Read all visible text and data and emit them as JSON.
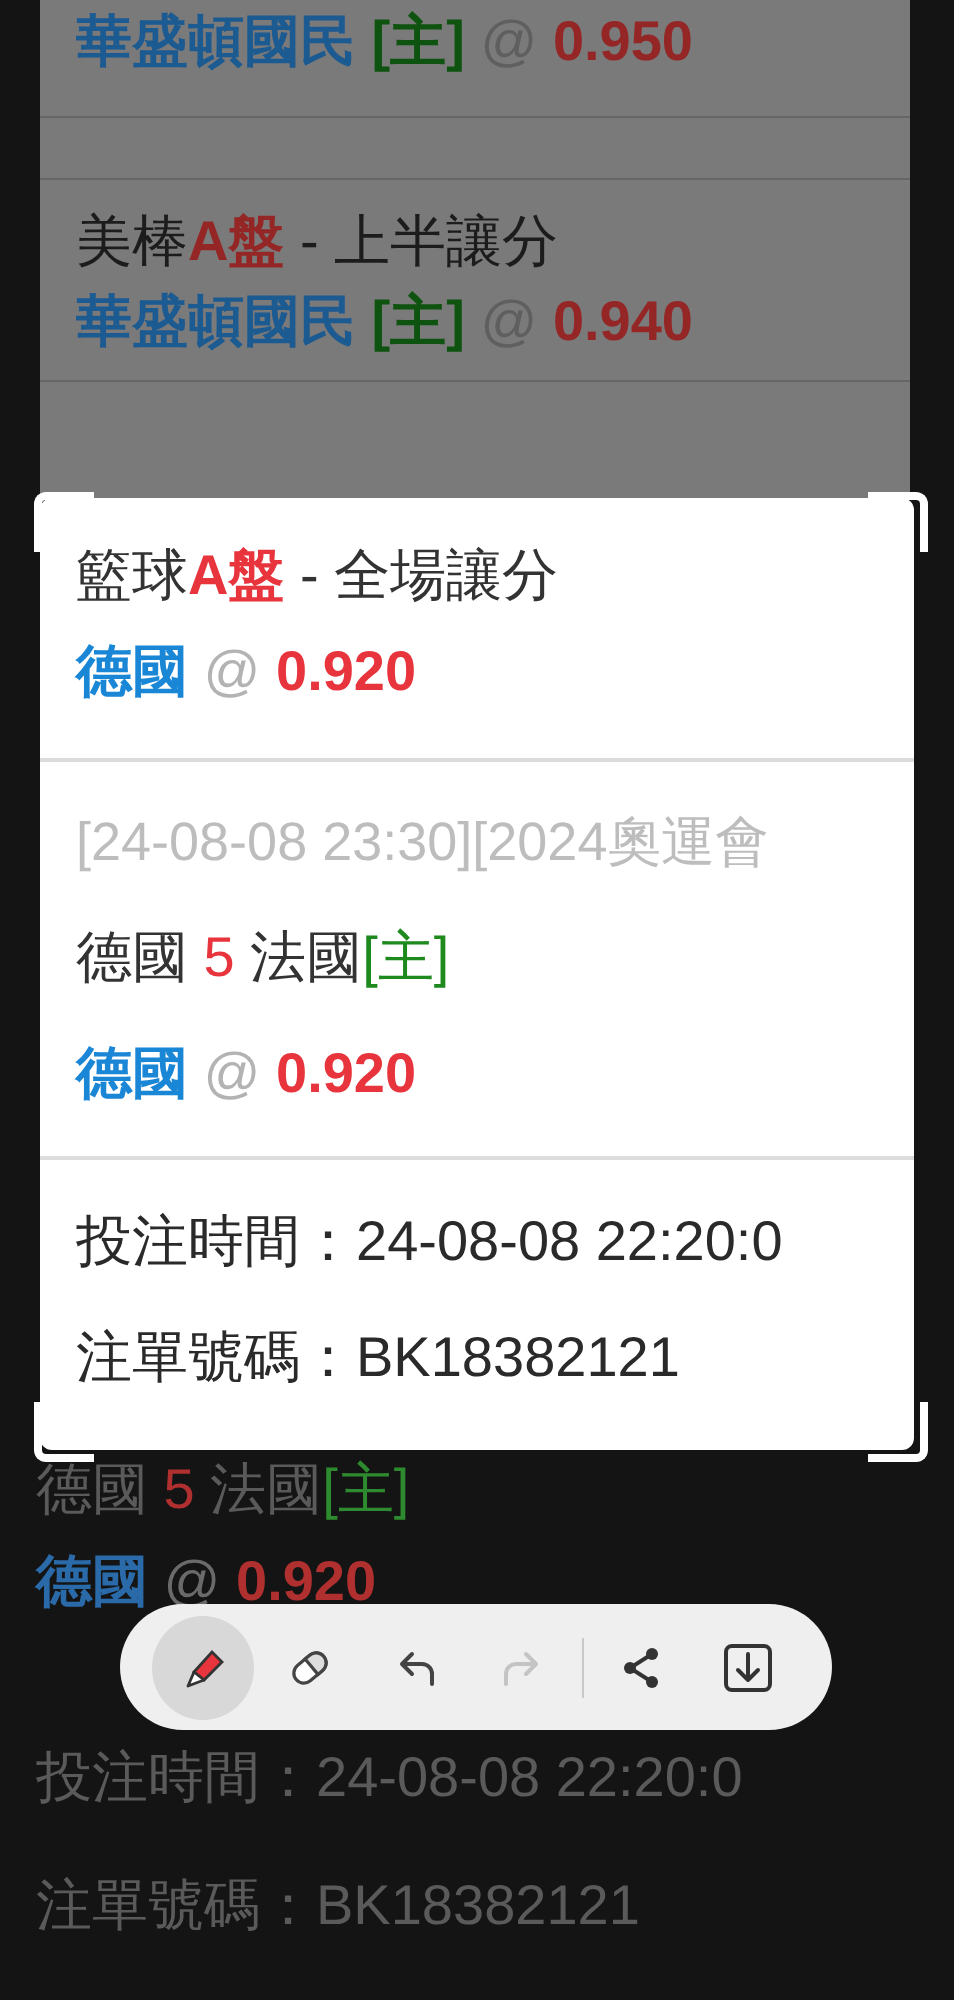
{
  "background": {
    "bets": [
      {
        "pick": {
          "team": "華盛頓國民",
          "home_tag": "[主]",
          "at": "@",
          "odds": "0.950"
        }
      },
      {
        "market": {
          "sport": "美棒",
          "code": "A盤",
          "name": " - 上半讓分"
        },
        "pick": {
          "team": "華盛頓國民",
          "home_tag": "[主]",
          "at": "@",
          "odds": "0.940"
        }
      }
    ],
    "lower": {
      "match": {
        "home": "德國",
        "score": "5",
        "away": "法國",
        "home_tag": "[主]"
      },
      "pick": {
        "team": "德國",
        "at": "@",
        "odds": "0.920"
      },
      "bet_time": "投注時間：24-08-08 22:20:0",
      "bet_id": "注單號碼：BK18382121"
    }
  },
  "crop_card": {
    "market": {
      "sport": "籃球",
      "code": "A盤",
      "name": " - 全場讓分"
    },
    "pick": {
      "team": "德國",
      "at": "@",
      "odds": "0.920"
    },
    "event": "[24-08-08 23:30][2024奧運會",
    "match": {
      "home": "德國",
      "score": "5",
      "away": "法國",
      "home_tag": "[主]"
    },
    "match_pick": {
      "team": "德國",
      "at": "@",
      "odds": "0.920"
    },
    "bet_time": "投注時間：24-08-08 22:20:0",
    "bet_id": "注單號碼：BK18382121"
  },
  "toolbar": {
    "tools": [
      {
        "kind": "pen",
        "selected": true
      },
      {
        "kind": "eraser",
        "selected": false
      }
    ],
    "history": [
      {
        "kind": "undo",
        "disabled": false
      },
      {
        "kind": "redo",
        "disabled": true
      }
    ],
    "actions": [
      {
        "kind": "share"
      },
      {
        "kind": "save"
      }
    ]
  }
}
